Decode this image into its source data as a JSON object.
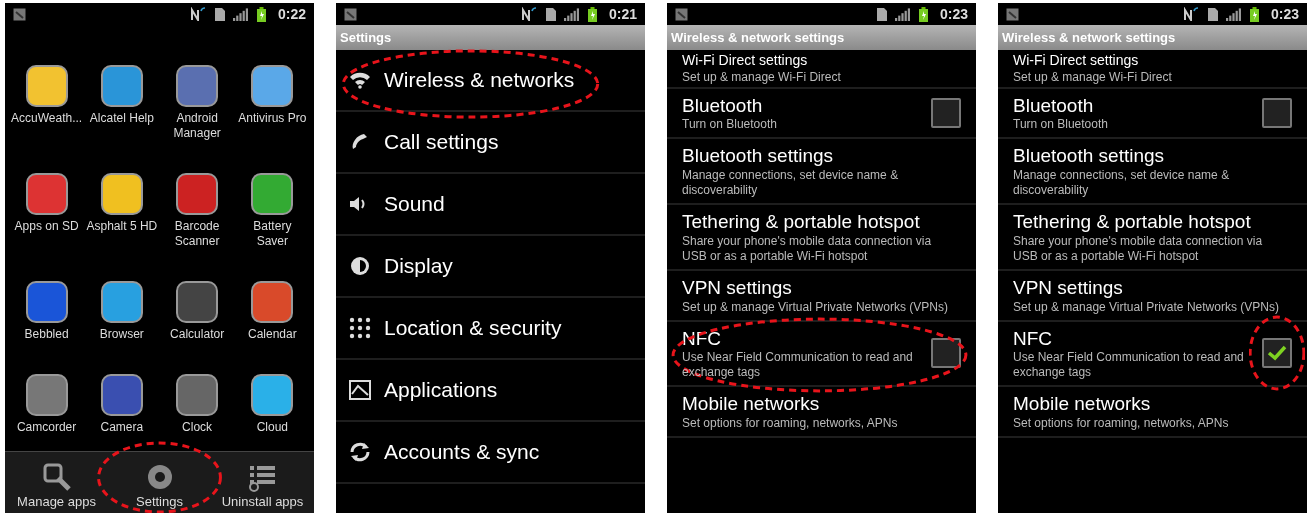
{
  "screens": [
    {
      "kind": "launcher",
      "status_bar": {
        "nfc": true,
        "time": "0:22"
      },
      "apps": [
        {
          "label": "AccuWeath..."
        },
        {
          "label": "Alcatel Help"
        },
        {
          "label": "Android Manager"
        },
        {
          "label": "Antivirus Pro"
        },
        {
          "label": "Apps on SD"
        },
        {
          "label": "Asphalt 5 HD"
        },
        {
          "label": "Barcode Scanner"
        },
        {
          "label": "Battery Saver"
        },
        {
          "label": "Bebbled"
        },
        {
          "label": "Browser"
        },
        {
          "label": "Calculator"
        },
        {
          "label": "Calendar"
        },
        {
          "label": "Camcorder"
        },
        {
          "label": "Camera"
        },
        {
          "label": "Clock"
        },
        {
          "label": "Cloud"
        }
      ],
      "dock": [
        {
          "label": "Manage apps",
          "highlighted": false
        },
        {
          "label": "Settings",
          "highlighted": true
        },
        {
          "label": "Uninstall apps",
          "highlighted": false
        }
      ]
    },
    {
      "kind": "menu",
      "status_bar": {
        "nfc": true,
        "time": "0:21"
      },
      "title": "Settings",
      "items": [
        {
          "label": "Wireless & networks",
          "highlighted": true
        },
        {
          "label": "Call settings",
          "highlighted": false
        },
        {
          "label": "Sound",
          "highlighted": false
        },
        {
          "label": "Display",
          "highlighted": false
        },
        {
          "label": "Location & security",
          "highlighted": false
        },
        {
          "label": "Applications",
          "highlighted": false
        },
        {
          "label": "Accounts & sync",
          "highlighted": false
        }
      ]
    },
    {
      "kind": "prefs",
      "status_bar": {
        "nfc": false,
        "time": "0:23"
      },
      "title": "Wireless & network settings",
      "items": [
        {
          "kind": "text",
          "title": "Wi-Fi Direct settings",
          "summary": "Set up & manage Wi-Fi Direct",
          "highlighted": false
        },
        {
          "kind": "checkbox",
          "title": "Bluetooth",
          "summary": "Turn on Bluetooth",
          "checked": false,
          "highlighted": false,
          "checkbox_highlighted": false
        },
        {
          "kind": "text",
          "title": "Bluetooth settings",
          "summary": "Manage connections, set device name & discoverability",
          "highlighted": false
        },
        {
          "kind": "text",
          "title": "Tethering & portable hotspot",
          "summary": "Share your phone's mobile data connection via USB or as a portable Wi-Fi hotspot",
          "highlighted": false
        },
        {
          "kind": "text",
          "title": "VPN settings",
          "summary": "Set up & manage Virtual Private Networks (VPNs)",
          "highlighted": false
        },
        {
          "kind": "checkbox",
          "title": "NFC",
          "summary": "Use Near Field Communication to read and exchange tags",
          "checked": false,
          "highlighted": true,
          "checkbox_highlighted": false
        },
        {
          "kind": "text",
          "title": "Mobile networks",
          "summary": "Set options for roaming, networks, APNs",
          "highlighted": false
        }
      ]
    },
    {
      "kind": "prefs",
      "status_bar": {
        "nfc": true,
        "time": "0:23"
      },
      "title": "Wireless & network settings",
      "items": [
        {
          "kind": "text",
          "title": "Wi-Fi Direct settings",
          "summary": "Set up & manage Wi-Fi Direct",
          "highlighted": false
        },
        {
          "kind": "checkbox",
          "title": "Bluetooth",
          "summary": "Turn on Bluetooth",
          "checked": false,
          "highlighted": false,
          "checkbox_highlighted": false
        },
        {
          "kind": "text",
          "title": "Bluetooth settings",
          "summary": "Manage connections, set device name & discoverability",
          "highlighted": false
        },
        {
          "kind": "text",
          "title": "Tethering & portable hotspot",
          "summary": "Share your phone's mobile data connection via USB or as a portable Wi-Fi hotspot",
          "highlighted": false
        },
        {
          "kind": "text",
          "title": "VPN settings",
          "summary": "Set up & manage Virtual Private Networks (VPNs)",
          "highlighted": false
        },
        {
          "kind": "checkbox",
          "title": "NFC",
          "summary": "Use Near Field Communication to read and exchange tags",
          "checked": true,
          "highlighted": false,
          "checkbox_highlighted": true
        },
        {
          "kind": "text",
          "title": "Mobile networks",
          "summary": "Set options for roaming, networks, APNs",
          "highlighted": false
        }
      ]
    }
  ]
}
